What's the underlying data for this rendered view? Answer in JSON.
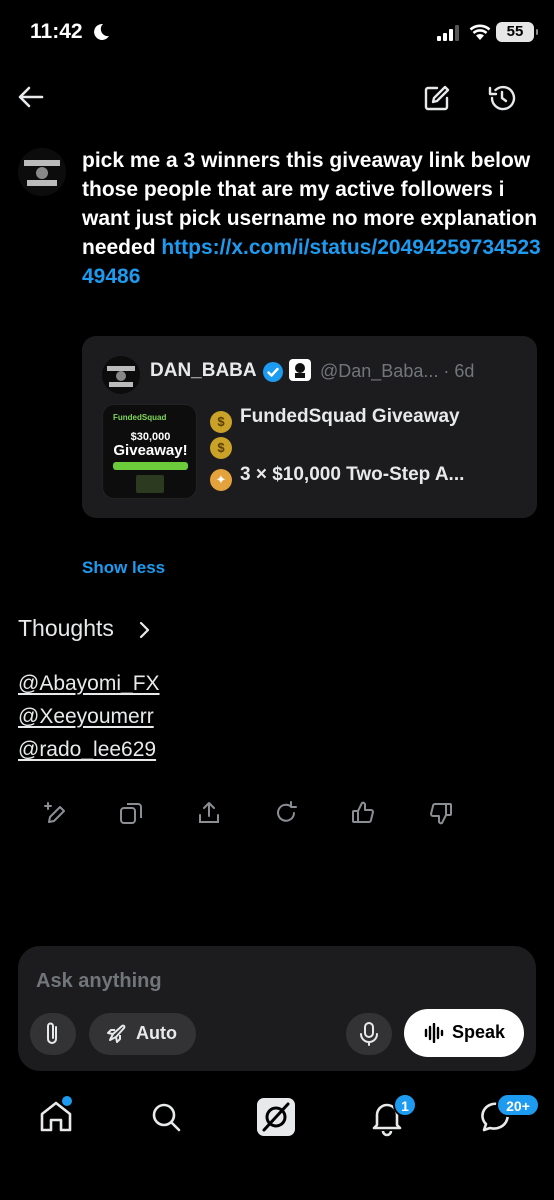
{
  "status_bar": {
    "time": "11:42",
    "battery": "55"
  },
  "message": {
    "text": "pick me a 3 winners  this giveaway link below those people that are my active followers i want just pick username no more explanation needed ",
    "link": "https://x.com/i/status/2049425973452349486"
  },
  "quote": {
    "name": "DAN_BABA",
    "handle": "@Dan_Baba...",
    "age": "· 6d",
    "line1": "FundedSquad Giveaway",
    "line2": "3 × $10,000 Two-Step A...",
    "thumb": {
      "brand": "FundedSquad",
      "amount": "$30,000",
      "title": "Giveaway!"
    }
  },
  "show_less": "Show less",
  "thoughts_label": "Thoughts",
  "answer": [
    "@Abayomi_FX",
    "@Xeeyoumerr",
    "@rado_lee629"
  ],
  "compose": {
    "placeholder": "Ask anything",
    "mode": "Auto",
    "speak": "Speak"
  },
  "nav": {
    "notifications_badge": "1",
    "messages_badge": "20+"
  },
  "colors": {
    "accent": "#1d9bf0",
    "background": "#000000",
    "surface": "#1c1c1e"
  }
}
